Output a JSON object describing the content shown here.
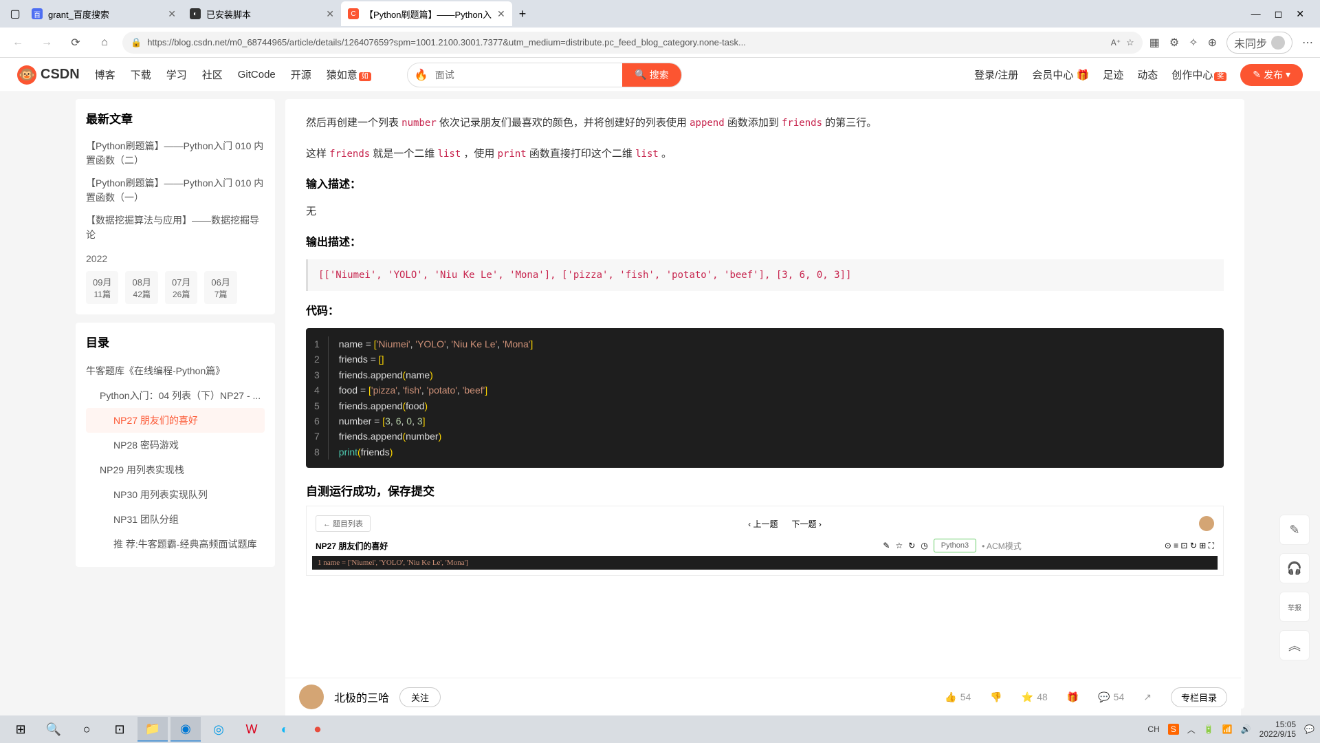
{
  "tabs": [
    {
      "title": "grant_百度搜索",
      "fav_bg": "#4e6ef2"
    },
    {
      "title": "已安装脚本",
      "fav_bg": "#333"
    },
    {
      "title": "【Python刷题篇】——Python入",
      "fav_bg": "#fc5531"
    }
  ],
  "url": "https://blog.csdn.net/m0_68744965/article/details/126407659?spm=1001.2100.3001.7377&utm_medium=distribute.pc_feed_blog_category.none-task...",
  "profile_label": "未同步",
  "csdn": {
    "logo": "CSDN",
    "nav": [
      "博客",
      "下载",
      "学习",
      "社区",
      "GitCode",
      "开源",
      "猿如意"
    ],
    "search_placeholder": "面试",
    "search_btn": "搜索",
    "right": [
      "登录/注册",
      "会员中心",
      "足迹",
      "动态",
      "创作中心"
    ],
    "publish": "发布"
  },
  "sidebar": {
    "latest_title": "最新文章",
    "latest": [
      "【Python刷题篇】——Python入门 010 内置函数（二）",
      "【Python刷题篇】——Python入门 010 内置函数（一）",
      "【数据挖掘算法与应用】——数据挖掘导论"
    ],
    "year": "2022",
    "months": [
      {
        "m": "09月",
        "c": "11篇"
      },
      {
        "m": "08月",
        "c": "42篇"
      },
      {
        "m": "07月",
        "c": "26篇"
      },
      {
        "m": "06月",
        "c": "7篇"
      }
    ],
    "toc_title": "目录",
    "toc": [
      {
        "t": "牛客题库《在线编程-Python篇》",
        "lvl": 1
      },
      {
        "t": "Python入门：04 列表（下）NP27 - ...",
        "lvl": 2
      },
      {
        "t": "NP27 朋友们的喜好",
        "lvl": 3,
        "active": true
      },
      {
        "t": "NP28 密码游戏",
        "lvl": 3
      },
      {
        "t": "NP29 用列表实现栈",
        "lvl": 2
      },
      {
        "t": "NP30 用列表实现队列",
        "lvl": 3
      },
      {
        "t": "NP31 团队分组",
        "lvl": 3
      },
      {
        "t": "推 荐:牛客题霸-经典高频面试题库",
        "lvl": 3
      }
    ]
  },
  "article": {
    "para1_prefix": "然后再创建一个列表 ",
    "para1_code1": "number",
    "para1_mid": " 依次记录朋友们最喜欢的颜色，并将创建好的列表使用 ",
    "para1_code2": "append",
    "para1_mid2": " 函数添加到 ",
    "para1_code3": "friends",
    "para1_suffix": " 的第三行。",
    "para2_prefix": "这样 ",
    "para2_code1": "friends",
    "para2_mid": " 就是一个二维 ",
    "para2_code2": "list",
    "para2_mid2": " ，使用 ",
    "para2_code3": "print",
    "para2_mid3": " 函数直接打印这个二维 ",
    "para2_code4": "list",
    "para2_suffix": " 。",
    "input_desc": "输入描述：",
    "input_none": "无",
    "output_desc": "输出描述：",
    "output_text": "[['Niumei', 'YOLO', 'Niu Ke Le', 'Mona'], ['pizza', 'fish', 'potato', 'beef'], [3, 6, 0, 3]]",
    "code_label": "代码：",
    "result_label": "自测运行成功，保存提交",
    "result_back": "← 题目列表",
    "result_prev": "‹ 上一题",
    "result_next": "下一题 ›",
    "result_lang": "Python3",
    "result_mode": "• ACM模式",
    "result_title": "NP27  朋友们的喜好",
    "result_code_preview": "1 name = ['Niumei', 'YOLO', 'Niu Ke Le', 'Mona']"
  },
  "author": {
    "name": "北极的三哈",
    "follow": "关注",
    "likes": "54",
    "favs": "48",
    "comments": "54",
    "column": "专栏目录"
  },
  "float": {
    "report": "举报"
  },
  "taskbar": {
    "ime": "CH",
    "time": "15:05",
    "date": "2022/9/15"
  },
  "chart_data": {
    "type": "table",
    "title": "Python code listing",
    "lines": [
      "name = ['Niumei', 'YOLO', 'Niu Ke Le', 'Mona']",
      "friends = []",
      "friends.append(name)",
      "food = ['pizza', 'fish', 'potato', 'beef']",
      "friends.append(food)",
      "number = [3, 6, 0, 3]",
      "friends.append(number)",
      "print(friends)"
    ]
  }
}
